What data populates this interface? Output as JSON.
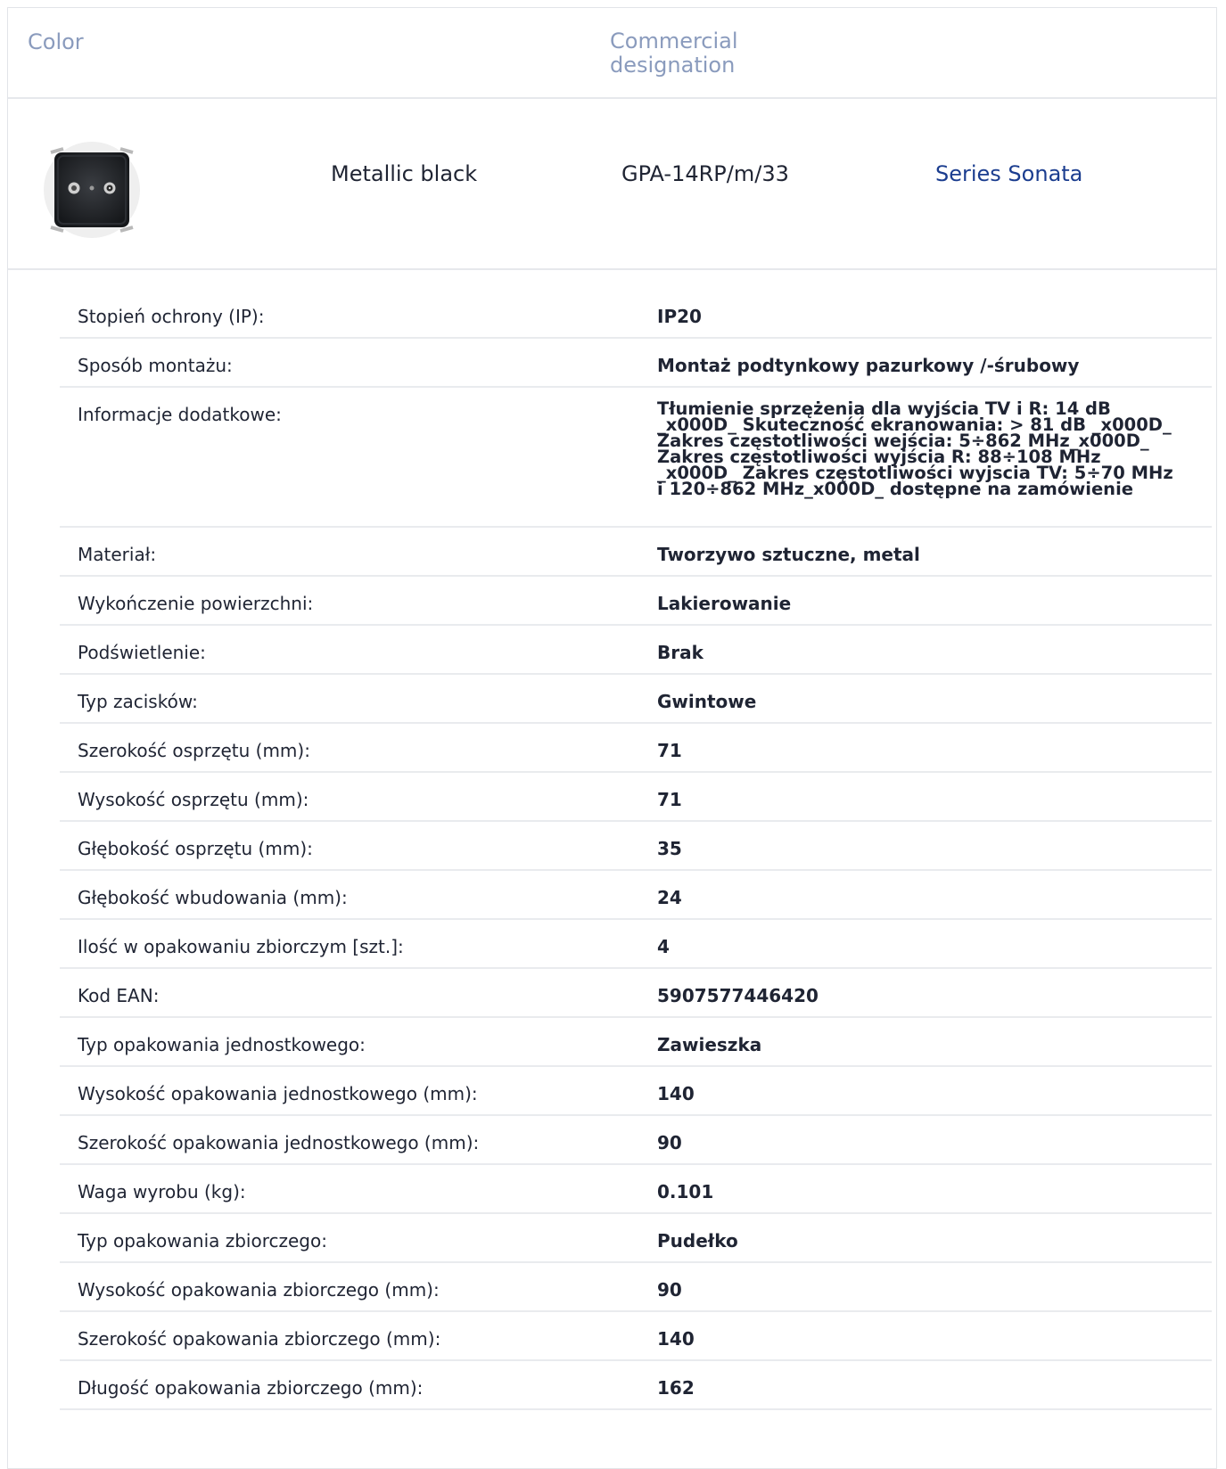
{
  "header": {
    "color_label": "Color",
    "designation_label": "Commercial designation"
  },
  "product": {
    "image_icon": "tv-radio-socket-black",
    "color": "Metallic black",
    "code": "GPA-14RP/m/33",
    "series_link": "Series Sonata"
  },
  "specs": [
    {
      "label": "Stopień ochrony (IP):",
      "value": "IP20"
    },
    {
      "label": "Sposób montażu:",
      "value": "Montaż podtynkowy pazurkowy /-śrubowy"
    },
    {
      "label": "Informacje dodatkowe:",
      "value": " Tłumienie sprzężenia dla wyjścia TV i R: 14 dB _x000D_ Skuteczność ekranowania: > 81 dB _x000D_ Zakres częstotliwości wejścia: 5÷862 MHz_x000D_ Zakres częstotliwości wyjścia R: 88÷108 MHz _x000D_ Zakres częstotliwości wyjscia TV: 5÷70 MHz i 120÷862 MHz_x000D_ dostępne na zamówienie"
    },
    {
      "label": "Materiał:",
      "value": "Tworzywo sztuczne, metal"
    },
    {
      "label": "Wykończenie powierzchni:",
      "value": "Lakierowanie"
    },
    {
      "label": "Podświetlenie:",
      "value": "Brak"
    },
    {
      "label": "Typ zacisków:",
      "value": "Gwintowe"
    },
    {
      "label": "Szerokość osprzętu (mm):",
      "value": "71"
    },
    {
      "label": "Wysokość osprzętu (mm):",
      "value": "71"
    },
    {
      "label": "Głębokość osprzętu (mm):",
      "value": "35"
    },
    {
      "label": "Głębokość wbudowania (mm):",
      "value": "24"
    },
    {
      "label": "Ilość w opakowaniu zbiorczym [szt.]:",
      "value": "4"
    },
    {
      "label": "Kod EAN:",
      "value": "5907577446420"
    },
    {
      "label": "Typ opakowania jednostkowego:",
      "value": "Zawieszka"
    },
    {
      "label": "Wysokość opakowania jednostkowego (mm):",
      "value": "140"
    },
    {
      "label": "Szerokość opakowania jednostkowego (mm):",
      "value": "90"
    },
    {
      "label": "Waga wyrobu (kg):",
      "value": "0.101"
    },
    {
      "label": "Typ opakowania zbiorczego:",
      "value": "Pudełko"
    },
    {
      "label": "Wysokość opakowania zbiorczego (mm):",
      "value": "90"
    },
    {
      "label": "Szerokość opakowania zbiorczego (mm):",
      "value": "140"
    },
    {
      "label": "Długość opakowania zbiorczego (mm):",
      "value": "162"
    }
  ]
}
